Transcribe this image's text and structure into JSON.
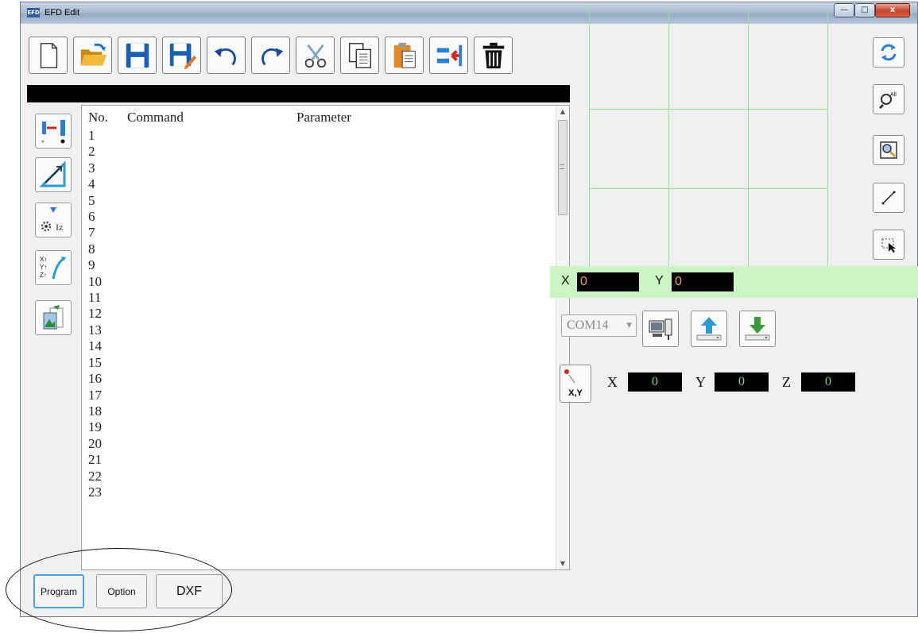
{
  "window": {
    "title": "EFD Edit",
    "app_icon_text": "EFD"
  },
  "caption_buttons": {
    "minimize": "—",
    "maximize": "□",
    "close": "x"
  },
  "toolbar": [
    {
      "name": "new-file-icon"
    },
    {
      "name": "open-folder-icon"
    },
    {
      "name": "save-icon"
    },
    {
      "name": "save-as-icon"
    },
    {
      "name": "undo-icon"
    },
    {
      "name": "redo-icon"
    },
    {
      "name": "cut-icon"
    },
    {
      "name": "copy-icon"
    },
    {
      "name": "paste-icon"
    },
    {
      "name": "insert-icon"
    },
    {
      "name": "delete-icon"
    }
  ],
  "list": {
    "headers": {
      "no": "No.",
      "command": "Command",
      "parameter": "Parameter"
    },
    "rows": [
      "1",
      "2",
      "3",
      "4",
      "5",
      "6",
      "7",
      "8",
      "9",
      "10",
      "11",
      "12",
      "13",
      "14",
      "15",
      "16",
      "17",
      "18",
      "19",
      "20",
      "21",
      "22",
      "23"
    ]
  },
  "side_tools": {
    "iz_label": "Iz",
    "axis_labels": [
      "X↑",
      "Y↑",
      "Z↑"
    ]
  },
  "coords": {
    "x_label": "X",
    "x_value": "0",
    "y_label": "Y",
    "y_value": "0"
  },
  "com": {
    "port": "COM14"
  },
  "position": {
    "button_label": "X,Y",
    "x_label": "X",
    "x_value": "0",
    "y_label": "Y",
    "y_value": "0",
    "z_label": "Z",
    "z_value": "0"
  },
  "zoom_all_label": "All",
  "tabs": {
    "program": "Program",
    "option": "Option",
    "dxf": "DXF"
  },
  "colors": {
    "grid": "#8de88d",
    "coord_band": "#ccf5c4",
    "value_orange": "#f0a23a",
    "value_green": "#8fd18a"
  }
}
